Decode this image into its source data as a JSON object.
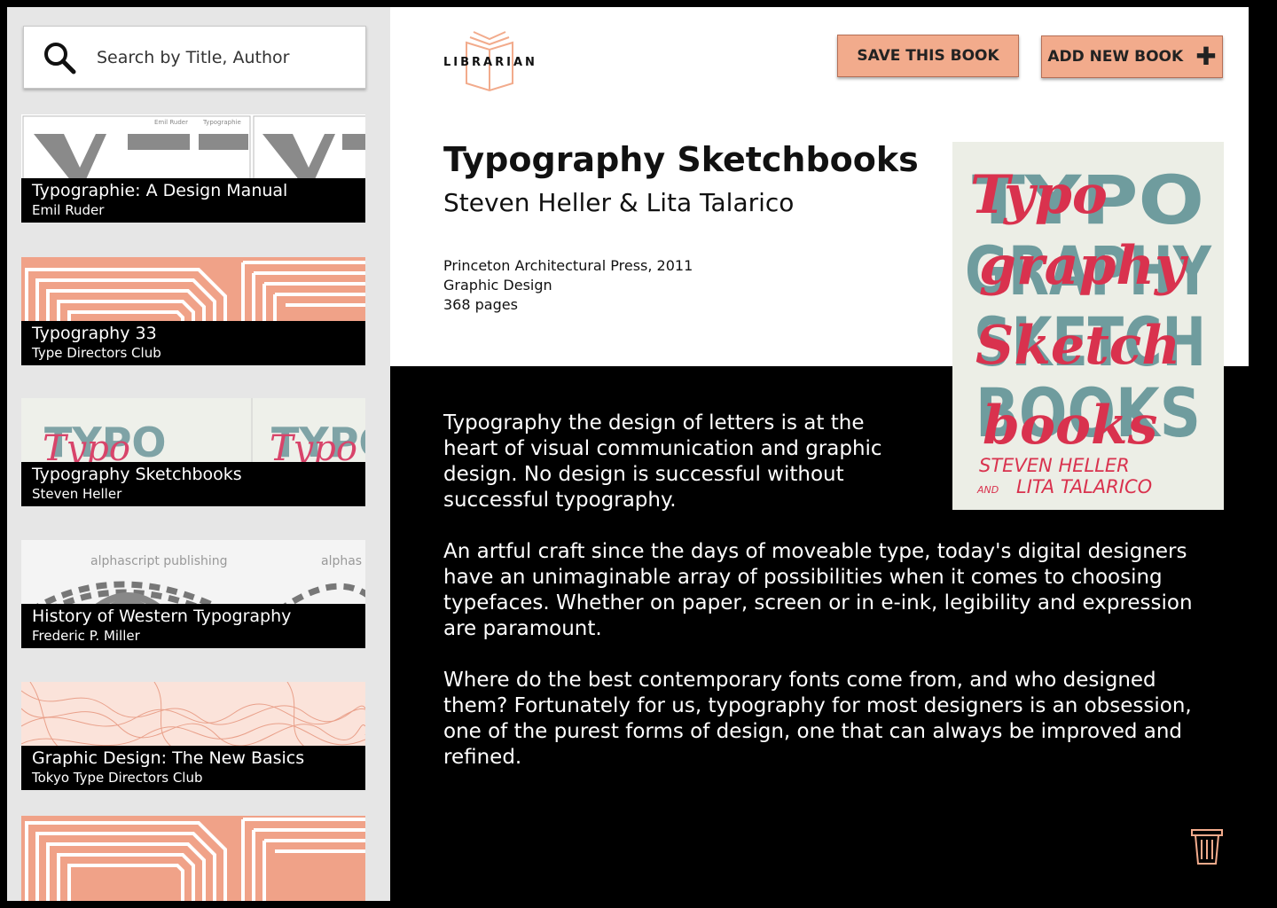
{
  "search": {
    "placeholder": "Search by Title, Author"
  },
  "sidebar": {
    "books": [
      {
        "title": "Typographie: A Design Manual",
        "author": "Emil Ruder"
      },
      {
        "title": "Typography 33",
        "author": "Type Directors Club"
      },
      {
        "title": "Typography Sketchbooks",
        "author": "Steven Heller"
      },
      {
        "title": "History of Western Typography",
        "author": "Frederic P. Miller"
      },
      {
        "title": "Graphic Design: The New Basics",
        "author": "Tokyo Type Directors Club"
      }
    ],
    "art_text": {
      "ruder_a": "Emil Ruder",
      "ruder_b": "Typographie",
      "alpha_a": "alphascript publishing",
      "alpha_b": "alphas",
      "typo_a": "TYPO",
      "typo_b": "Typo"
    }
  },
  "logo": {
    "text": "LIBRARIAN"
  },
  "toolbar": {
    "save_label": "SAVE THIS BOOK",
    "add_label": "ADD NEW BOOK"
  },
  "book": {
    "title": "Typography Sketchbooks",
    "authors": "Steven Heller & Lita Talarico",
    "publisher": "Princeton Architectural Press, 2011",
    "category": "Graphic Design",
    "pages": "368 pages",
    "cover_text": {
      "line1": "TYPO",
      "line2": "GRAPHY",
      "line3": "SKETCH",
      "line4": "BOOKS",
      "script1": "Typo",
      "script2": "graphy",
      "script3": "Sketch",
      "script4": "books",
      "author1": "STEVEN HELLER",
      "author2": "LITA TALARICO",
      "and": "AND"
    },
    "description": [
      "Typography the design of letters is at the heart of visual communication and graphic design. No design is successful without successful typography.",
      "An artful craft since the days of moveable type, today's digital designers have an unimaginable array of possibilities when it comes to choosing typefaces. Whether on paper, screen or in e-ink, legibility and expression are paramount.",
      "Where do the best contemporary fonts come from, and who designed them? Fortunately for us, typography for most designers is an obsession, one of the purest forms of design, one that can always be improved and refined."
    ]
  },
  "colors": {
    "accent": "#f2ab8c",
    "accent_border": "#b56f56",
    "sidebar_bg": "#e6e6e6",
    "salmon": "#f0a288"
  },
  "icons": {
    "search": "search-icon",
    "logo": "book-icon",
    "add": "plus-icon",
    "delete": "trash-icon"
  }
}
